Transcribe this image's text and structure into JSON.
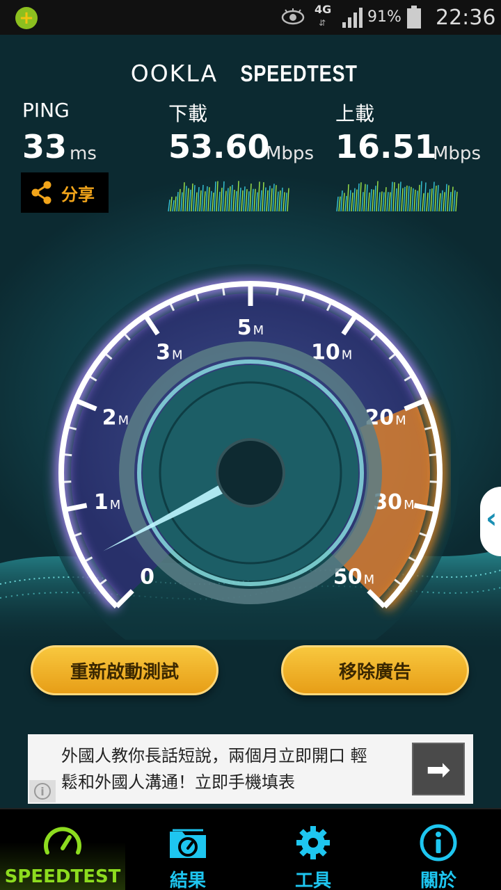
{
  "status_bar": {
    "network": "4G",
    "network_arrows": "⇵",
    "battery": "91%",
    "time": "22:36"
  },
  "brand": {
    "ookla": "OOKLA",
    "speedtest": "SPEEDTEST"
  },
  "metrics": {
    "ping": {
      "label": "PING",
      "value": "33",
      "unit": "ms"
    },
    "download": {
      "label": "下載",
      "value": "53.60",
      "unit": "Mbps"
    },
    "upload": {
      "label": "上載",
      "value": "16.51",
      "unit": "Mbps"
    }
  },
  "share": {
    "label": "分享",
    "icon": "share-icon"
  },
  "gauge": {
    "ticks": [
      {
        "num": "0",
        "suffix": ""
      },
      {
        "num": "1",
        "suffix": "M"
      },
      {
        "num": "2",
        "suffix": "M"
      },
      {
        "num": "3",
        "suffix": "M"
      },
      {
        "num": "5",
        "suffix": "M"
      },
      {
        "num": "10",
        "suffix": "M"
      },
      {
        "num": "20",
        "suffix": "M"
      },
      {
        "num": "30",
        "suffix": "M"
      },
      {
        "num": "50",
        "suffix": "M"
      }
    ],
    "accent": "#f08a24"
  },
  "buttons": {
    "restart": "重新啟動測試",
    "remove_ads": "移除廣告"
  },
  "ad": {
    "text_line1": "外國人教你長話短說，兩個月立即開口 輕",
    "text_line2": "鬆和外國人溝通！立即手機填表",
    "info_icon": "i",
    "arrow": "➡"
  },
  "tabs": [
    {
      "label": "SPEEDTEST",
      "icon": "speedometer-icon"
    },
    {
      "label": "結果",
      "icon": "folder-gauge-icon"
    },
    {
      "label": "工具",
      "icon": "gear-icon"
    },
    {
      "label": "關於",
      "icon": "info-icon"
    }
  ],
  "colors": {
    "accent_green": "#8ddc1f",
    "accent_blue": "#1ec6f0",
    "button_gold": "#f2b12a"
  }
}
